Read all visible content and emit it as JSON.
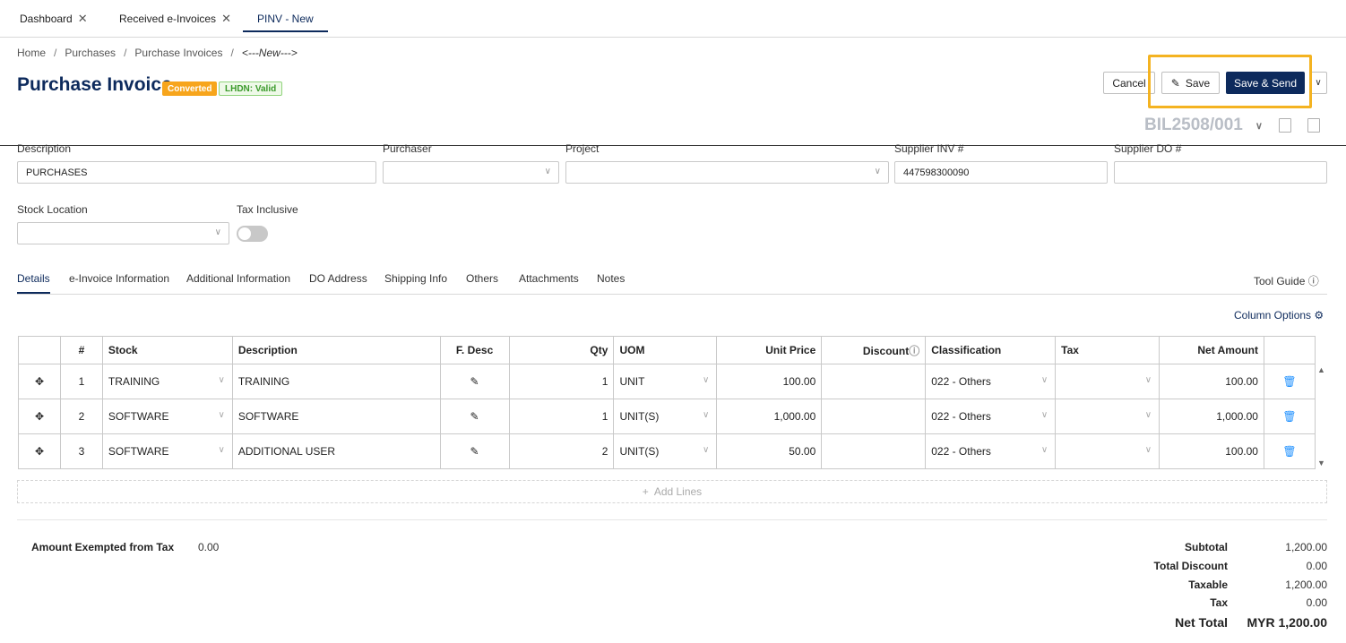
{
  "tabs": [
    {
      "label": "Dashboard",
      "closable": true
    },
    {
      "label": "Received e-Invoices",
      "closable": true
    },
    {
      "label": "PINV - New",
      "closable": false,
      "active": true
    }
  ],
  "breadcrumb": [
    "Home",
    "Purchases",
    "Purchase Invoices",
    "<---New--->"
  ],
  "page": {
    "title": "Purchase Invoice",
    "badge_converted": "Converted",
    "badge_lhdn": "LHDN: Valid",
    "doc_no": "BIL2508/001"
  },
  "actions": {
    "cancel": "Cancel",
    "save": "Save",
    "save_send": "Save & Send"
  },
  "form": {
    "description_label": "Description",
    "description_value": "PURCHASES",
    "purchaser_label": "Purchaser",
    "purchaser_value": "",
    "project_label": "Project",
    "project_value": "",
    "supplier_inv_label": "Supplier INV #",
    "supplier_inv_value": "447598300090",
    "supplier_do_label": "Supplier DO #",
    "supplier_do_value": "",
    "stock_location_label": "Stock Location",
    "stock_location_value": "",
    "tax_inclusive_label": "Tax Inclusive",
    "tax_inclusive": false
  },
  "detail_tabs": [
    "Details",
    "e-Invoice Information",
    "Additional Information",
    "DO Address",
    "Shipping Info",
    "Others",
    "Attachments",
    "Notes"
  ],
  "tool_guide": "Tool Guide",
  "column_options": "Column Options",
  "table": {
    "headers": [
      "#",
      "Stock",
      "Description",
      "F. Desc",
      "Qty",
      "UOM",
      "Unit Price",
      "Discount",
      "Classification",
      "Tax",
      "Net Amount"
    ],
    "rows": [
      {
        "no": "1",
        "stock": "TRAINING",
        "description": "TRAINING",
        "qty": "1",
        "uom": "UNIT",
        "unit_price": "100.00",
        "discount": "",
        "classification": "022 - Others",
        "tax": "",
        "net_amount": "100.00"
      },
      {
        "no": "2",
        "stock": "SOFTWARE",
        "description": "SOFTWARE",
        "qty": "1",
        "uom": "UNIT(S)",
        "unit_price": "1,000.00",
        "discount": "",
        "classification": "022 - Others",
        "tax": "",
        "net_amount": "1,000.00"
      },
      {
        "no": "3",
        "stock": "SOFTWARE",
        "description": "ADDITIONAL USER",
        "qty": "2",
        "uom": "UNIT(S)",
        "unit_price": "50.00",
        "discount": "",
        "classification": "022 - Others",
        "tax": "",
        "net_amount": "100.00"
      }
    ]
  },
  "add_lines": "Add Lines",
  "summary": {
    "exempt_label": "Amount Exempted from Tax",
    "exempt_value": "0.00",
    "subtotal_label": "Subtotal",
    "subtotal_value": "1,200.00",
    "total_discount_label": "Total Discount",
    "total_discount_value": "0.00",
    "taxable_label": "Taxable",
    "taxable_value": "1,200.00",
    "tax_label": "Tax",
    "tax_value": "0.00",
    "net_total_label": "Net Total",
    "net_total_value": "MYR 1,200.00"
  },
  "colors": {
    "primary": "#0d2a5c",
    "converted": "#f7a51c",
    "lhdn_green": "#3a9a2a",
    "highlight": "#f4b321",
    "trash": "#1e90ff"
  }
}
